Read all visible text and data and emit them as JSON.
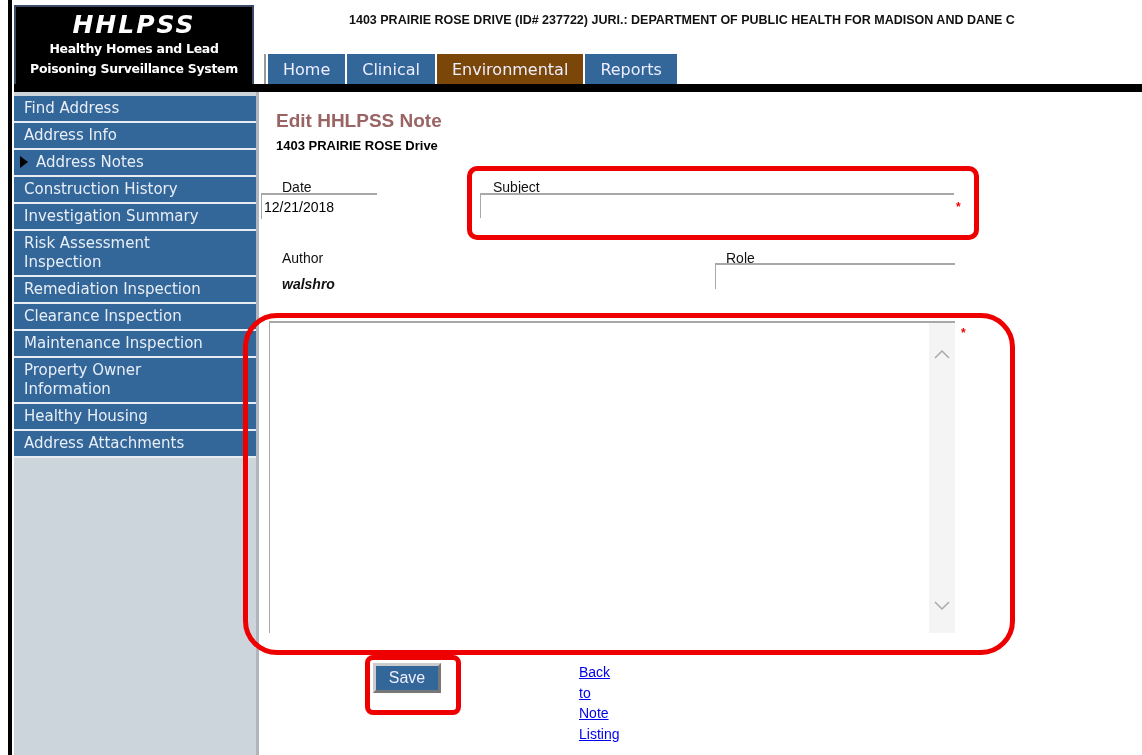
{
  "header": {
    "logo_title": "HHLPSS",
    "logo_subtitle_lines": [
      "Healthy Homes and Lead",
      "Poisoning Surveillance System"
    ],
    "address_line": "1403 PRAIRIE ROSE DRIVE (ID# 237722)  JURI.: DEPARTMENT OF PUBLIC HEALTH FOR MADISON AND DANE C"
  },
  "tabs": [
    {
      "label": "Home",
      "selected": false
    },
    {
      "label": "Clinical",
      "selected": false
    },
    {
      "label": "Environmental",
      "selected": true
    },
    {
      "label": "Reports",
      "selected": false
    }
  ],
  "sidebar": {
    "items": [
      {
        "label": "Find Address",
        "selected": false
      },
      {
        "label": "Address Info",
        "selected": false
      },
      {
        "label": "Address Notes",
        "selected": true
      },
      {
        "label": "Construction History",
        "selected": false
      },
      {
        "label": "Investigation Summary",
        "selected": false
      },
      {
        "label": "Risk Assessment Inspection",
        "selected": false
      },
      {
        "label": "Remediation Inspection",
        "selected": false
      },
      {
        "label": "Clearance Inspection",
        "selected": false
      },
      {
        "label": "Maintenance Inspection",
        "selected": false
      },
      {
        "label": "Property Owner Information",
        "selected": false
      },
      {
        "label": "Healthy Housing",
        "selected": false
      },
      {
        "label": "Address Attachments",
        "selected": false
      }
    ]
  },
  "form": {
    "title": "Edit HHLPSS Note",
    "address": "1403 PRAIRIE ROSE Drive",
    "date": {
      "label": "Date",
      "value": "12/21/2018"
    },
    "subject": {
      "label": "Subject",
      "required_mark": "*",
      "highlighted": true
    },
    "author": {
      "label": "Author",
      "value": "walshro"
    },
    "role": {
      "label": "Role"
    },
    "note": {
      "required_mark": "*",
      "highlighted": true
    },
    "save_button": {
      "label": "Save",
      "highlighted": true
    },
    "back_link": "Back to Note Listing"
  }
}
